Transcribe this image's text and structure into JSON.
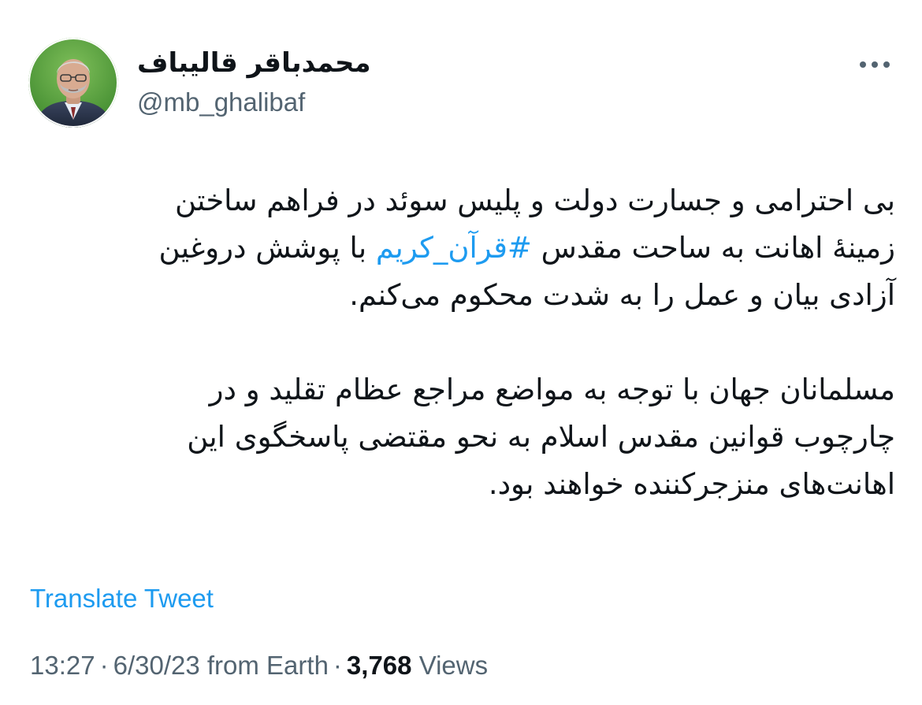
{
  "author": {
    "display_name": "محمدباقر قالیباف",
    "handle": "@mb_ghalibaf"
  },
  "tweet": {
    "paragraph1": [
      "بی احترامی و جسارت دولت و پلیس سوئد در فراهم ساختن",
      {
        "before": "زمینهٔ اهانت به ساحت مقدس ",
        "hashtag": "#قرآن_کریم",
        "after": " با پوشش دروغین"
      },
      "آزادی بیان و عمل را به شدت محکوم می‌کنم."
    ],
    "paragraph2": [
      "مسلمانان جهان با توجه به مواضع مراجع عظام تقلید و در",
      "چارچوب قوانین مقدس اسلام به نحو مقتضی پاسخگوی این",
      "اهانت‌های منزجرکننده خواهند بود."
    ]
  },
  "translate_label": "Translate Tweet",
  "meta": {
    "time": "13:27",
    "date": "6/30/23",
    "source": "from Earth",
    "separator": "·",
    "views_count": "3,768",
    "views_label": "Views"
  },
  "colors": {
    "link": "#1d9bf0",
    "secondary_text": "#536471",
    "primary_text": "#0f1419"
  },
  "icons": {
    "more": "more-horizontal-icon"
  }
}
